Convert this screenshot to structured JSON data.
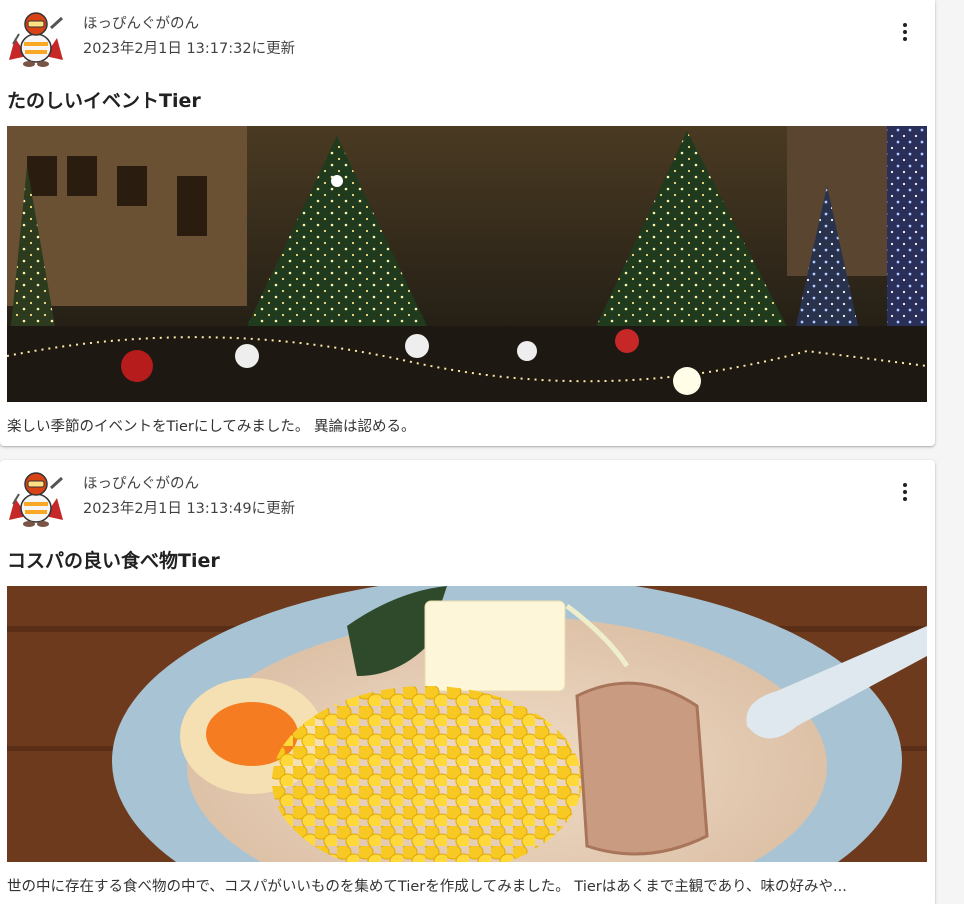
{
  "posts": [
    {
      "author": "ほっぴんぐがのん",
      "updated": "2023年2月1日 13:17:32に更新",
      "title": "たのしいイベントTier",
      "description": "楽しい季節のイベントをTierにしてみました。 異論は認める。",
      "image_icon": "christmas-lights-photo",
      "menu_icon": "more-vert-icon"
    },
    {
      "author": "ほっぴんぐがのん",
      "updated": "2023年2月1日 13:13:49に更新",
      "title": "コスパの良い食べ物Tier",
      "description": "世の中に存在する食べ物の中で、コスパがいいものを集めてTierを作成してみました。 Tierはあくまで主観であり、味の好みや...",
      "image_icon": "ramen-photo",
      "menu_icon": "more-vert-icon"
    }
  ],
  "colors": {
    "card_background": "#ffffff",
    "page_background": "#f5f5f5",
    "text_primary": "#212121",
    "text_secondary": "#424242"
  }
}
